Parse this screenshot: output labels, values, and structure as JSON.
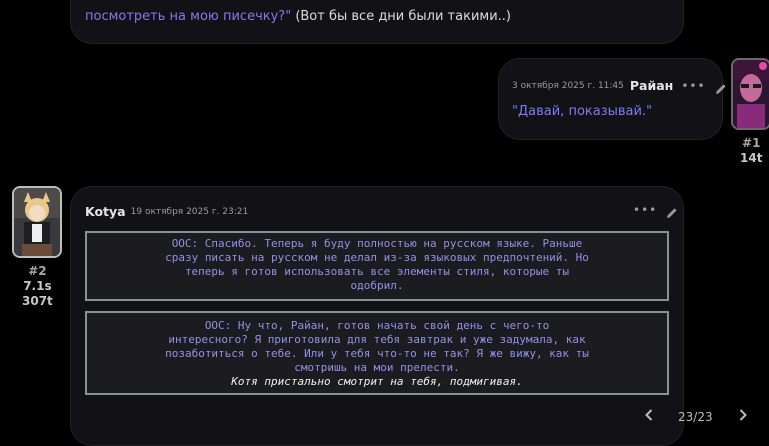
{
  "top_message": {
    "line1_tail": "посмотреть на мою писечку?\"",
    "line2_plain": " (Вот бы все дни были такими..)"
  },
  "user_message": {
    "timestamp": "3 октября 2025 г. 11:45",
    "name": "Райан",
    "text": "\"Давай, показывай.\"",
    "meta": {
      "number": "#1",
      "tokens": "14t"
    }
  },
  "kotya_message": {
    "name": "Kotya",
    "timestamp": "19 октября 2025 г. 23:21",
    "meta": {
      "number": "#2",
      "time": "7.1s",
      "tokens": "307t"
    },
    "ooc1": [
      "ООС: Спасибо. Теперь я буду полностью на русском языке. Раньше",
      "сразу писать на русском не делал из-за языковых предпочтений. Но",
      "теперь я готов использовать все элементы стиля, которые ты",
      "одобрил."
    ],
    "ooc2": [
      "ООС: Ну что, Райан, готов начать свой день с чего-то",
      "интересного? Я приготовила для тебя завтрак и уже задумала, как",
      "позаботиться о тебе. Или у тебя что-то не так? Я же вижу, как ты",
      "смотришь на мои прелести."
    ],
    "action": "Котя пристально смотрит на тебя, подмигивая.",
    "swipe_counter": "23/23"
  },
  "icons": {
    "dots": "more-options-icon",
    "pencil": "edit-icon",
    "left": "chevron-left-icon",
    "right": "chevron-right-icon"
  }
}
